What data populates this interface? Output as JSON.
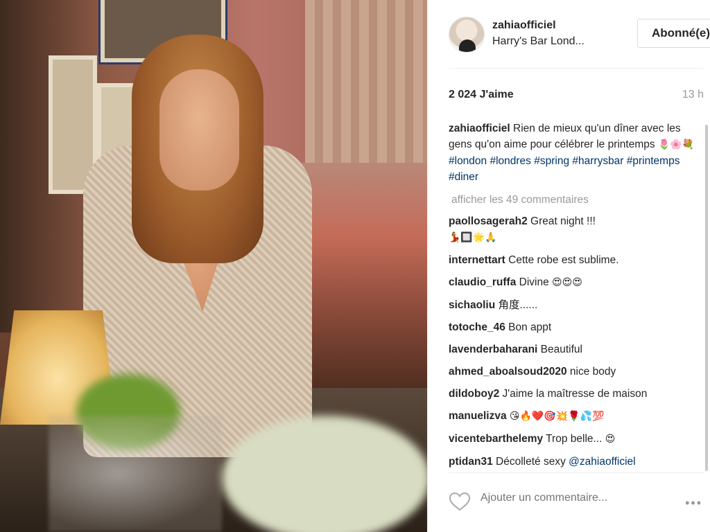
{
  "post": {
    "username": "zahiaofficiel",
    "location": "Harry's Bar Lond...",
    "follow_label": "Abonné(e)",
    "likes": "2 024 J'aime",
    "time": "13 h"
  },
  "caption": {
    "username": "zahiaofficiel",
    "text": "Rien de mieux qu'un dîner avec les gens qu'on aime pour célébrer le printemps",
    "emojis": "🌷🌸💐",
    "tags": "#london #londres #spring #harrysbar #printemps #diner"
  },
  "more_comments": "afficher les 49 commentaires",
  "comments": [
    {
      "user": "paollosagerah2",
      "text": "Great night !!!",
      "emoji": "💃🔲🌟🙏"
    },
    {
      "user": "internettart",
      "text": "Cette robe est sublime.",
      "emoji": ""
    },
    {
      "user": "claudio_ruffa",
      "text": "Divine",
      "emoji": "😍😍😍"
    },
    {
      "user": "sichaoliu",
      "text": "角度......",
      "emoji": ""
    },
    {
      "user": "totoche_46",
      "text": "Bon appt",
      "emoji": ""
    },
    {
      "user": "lavenderbaharani",
      "text": "Beautiful",
      "emoji": ""
    },
    {
      "user": "ahmed_aboalsoud2020",
      "text": "nice body",
      "emoji": ""
    },
    {
      "user": "dildoboy2",
      "text": "J'aime la maîtresse de maison",
      "emoji": ""
    },
    {
      "user": "manuelizva",
      "text": "",
      "emoji": "😘🔥❤️🎯💥🌹💦💯"
    },
    {
      "user": "vicentebarthelemy",
      "text": "Trop belle...",
      "emoji": "😍"
    },
    {
      "user": "ptidan31",
      "text": "Décolleté sexy",
      "emoji": "",
      "mention": "@zahiaofficiel"
    }
  ],
  "footer": {
    "placeholder": "Ajouter un commentaire...",
    "more_icon": "•••"
  },
  "icons": {
    "like": "heart-outline-icon",
    "more": "ellipsis-icon"
  },
  "colors": {
    "accent_link": "#003569",
    "muted": "#999999",
    "border": "#dbdbdb"
  }
}
